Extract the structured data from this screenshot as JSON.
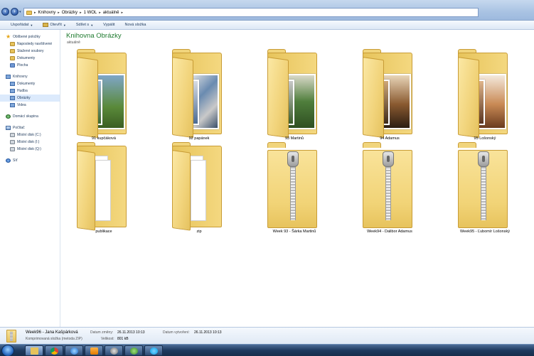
{
  "address": {
    "crumbs": [
      "Knihovny",
      "Obrázky",
      "1 WOL",
      "aktuálně"
    ]
  },
  "toolbar": {
    "organize": "Uspořádat",
    "open": "Otevřít",
    "share": "Sdílet s",
    "burn": "Vypálit",
    "new_folder": "Nová složka"
  },
  "sidebar": {
    "favorites": "Oblíbené položky",
    "recent": "Naposledy navštívené",
    "downloads": "Stažené soubory",
    "documents_fav": "Dokumenty",
    "desktop": "Plocha",
    "libraries": "Knihovny",
    "documents": "Dokumenty",
    "music": "Hudba",
    "pictures": "Obrázky",
    "videos": "Videa",
    "homegroup": "Domácí skupina",
    "computer": "Počítač",
    "disk_c": "Místní disk (C:)",
    "disk_i": "Místní disk (I:)",
    "disk_q": "Místní disk (Q:)",
    "network": "Síť"
  },
  "main": {
    "title": "Knihovna Obrázky",
    "subtitle": "aktuálně",
    "items": [
      {
        "label": "91 kupčáková",
        "kind": "photos"
      },
      {
        "label": "92 papánek",
        "kind": "photos"
      },
      {
        "label": "93 Martinů",
        "kind": "photos"
      },
      {
        "label": "94 Adamus",
        "kind": "photos"
      },
      {
        "label": "95 Lošonský",
        "kind": "photos"
      },
      {
        "label": "publikace",
        "kind": "papers"
      },
      {
        "label": "zip",
        "kind": "papers"
      },
      {
        "label": "Week 93 - Šárka Martinů",
        "kind": "zip"
      },
      {
        "label": "Week94 - Dalibor Adamus",
        "kind": "zip"
      },
      {
        "label": "Week95 - Ľubomír Lošonský",
        "kind": "zip"
      }
    ]
  },
  "details": {
    "name": "Week96 - Jana Kašpárková",
    "type": "Komprimovaná složka (metoda ZIP)",
    "modified_label": "Datum změny:",
    "modified_value": "26.11.2013 10:13",
    "size_label": "Velikost:",
    "size_value": "801 kB",
    "created_label": "Datum vytvoření:",
    "created_value": "26.11.2013 10:13"
  },
  "colors": {
    "accent_title": "#1e7a2e",
    "folder": "#f1d37a",
    "taskbar": "#1e3a5f"
  }
}
